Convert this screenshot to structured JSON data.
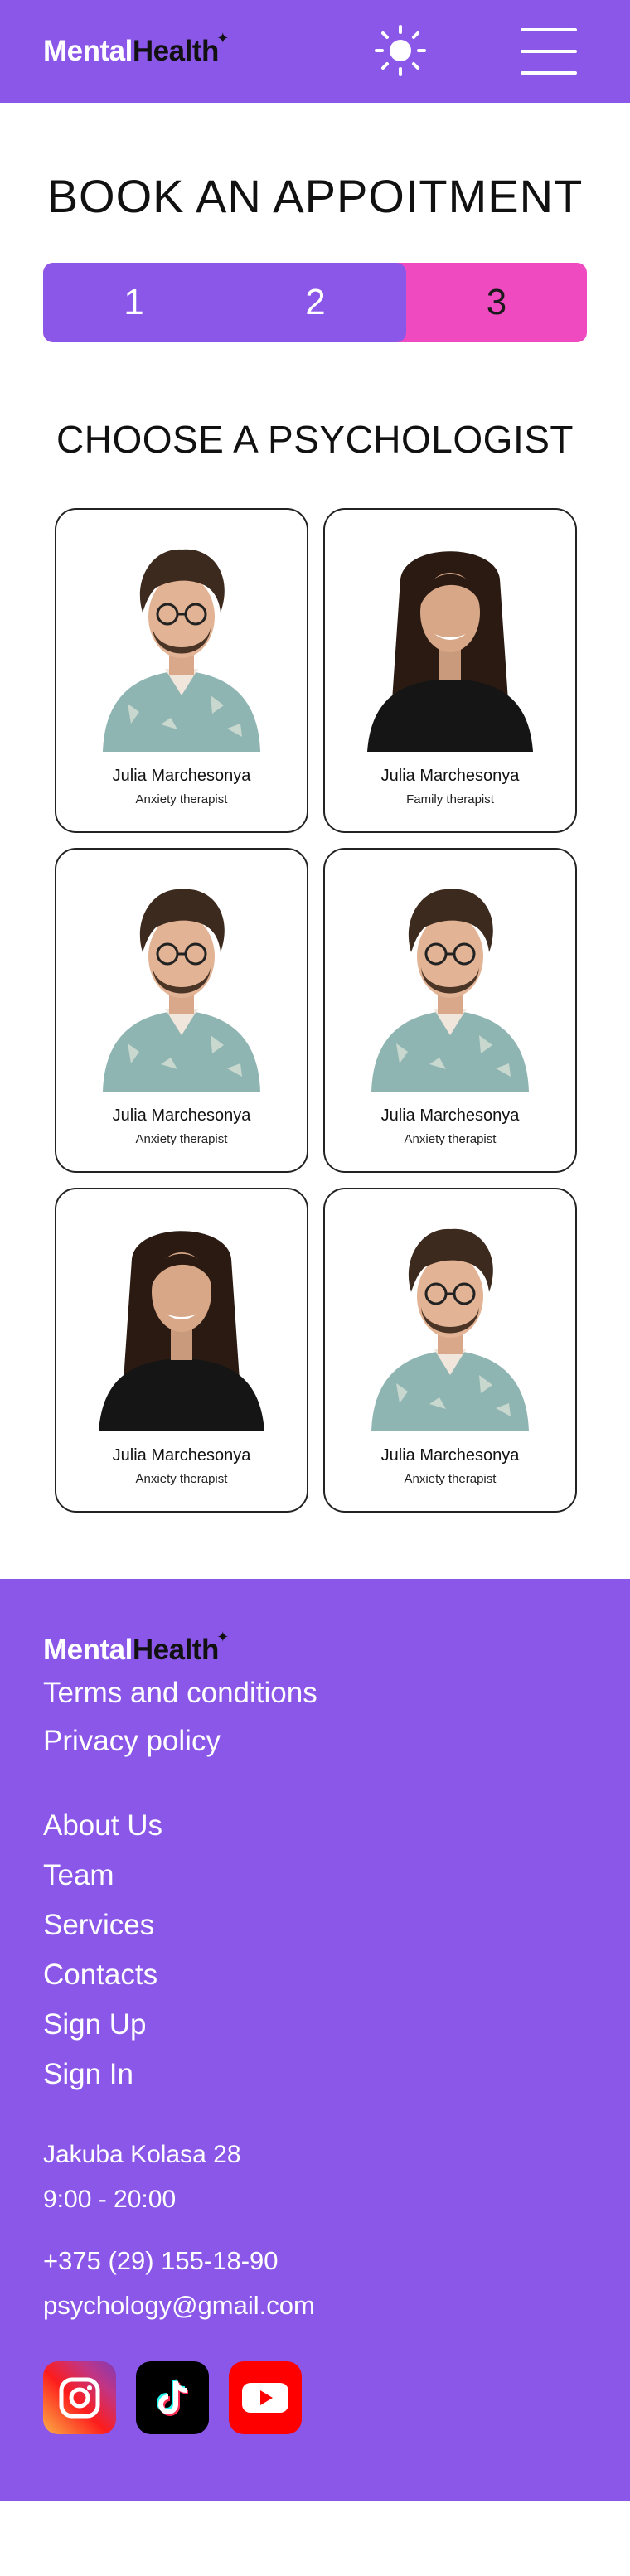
{
  "header": {
    "logo_part1": "Mental",
    "logo_part2": "Health",
    "theme_icon": "sun-icon",
    "menu_icon": "hamburger-menu-icon"
  },
  "page_title": "BOOK AN APPOITMENT",
  "stepper": {
    "steps": [
      "1",
      "2",
      "3"
    ],
    "active_step": 3,
    "colors": {
      "done": "#8b57e8",
      "active": "#f04ac0"
    }
  },
  "section_title": "CHOOSE A PSYCHOLOGIST",
  "psychologists": [
    {
      "name": "Julia Marchesonya",
      "role": "Anxiety therapist",
      "photo": "man-with-glasses-photo"
    },
    {
      "name": "Julia Marchesonya",
      "role": "Family therapist",
      "photo": "woman-long-hair-photo"
    },
    {
      "name": "Julia Marchesonya",
      "role": "Anxiety therapist",
      "photo": "man-with-glasses-photo"
    },
    {
      "name": "Julia Marchesonya",
      "role": "Anxiety therapist",
      "photo": "man-with-glasses-photo"
    },
    {
      "name": "Julia Marchesonya",
      "role": "Anxiety therapist",
      "photo": "woman-long-hair-photo"
    },
    {
      "name": "Julia Marchesonya",
      "role": "Anxiety therapist",
      "photo": "man-with-glasses-photo"
    }
  ],
  "footer": {
    "logo_part1": "Mental",
    "logo_part2": "Health",
    "legal": [
      "Terms and conditions",
      "Privacy policy"
    ],
    "nav": [
      "About Us",
      "Team",
      "Services",
      "Contacts",
      "Sign Up",
      "Sign In"
    ],
    "address": "Jakuba Kolasa 28",
    "hours": "9:00 - 20:00",
    "phone": "+375 (29) 155-18-90",
    "email": "psychology@gmail.com",
    "socials": [
      "instagram-icon",
      "tiktok-icon",
      "youtube-icon"
    ]
  },
  "colors": {
    "brand": "#8b57e8",
    "accent": "#f04ac0"
  }
}
